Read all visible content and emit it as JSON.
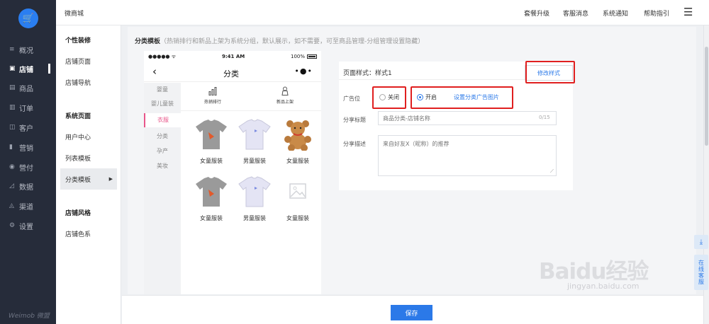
{
  "brand": "Weimob 微盟",
  "nav": [
    {
      "icon": "≡",
      "label": "概况",
      "active": false
    },
    {
      "icon": "▣",
      "label": "店铺",
      "active": true
    },
    {
      "icon": "▤",
      "label": "商品",
      "active": false
    },
    {
      "icon": "▥",
      "label": "订单",
      "active": false
    },
    {
      "icon": "◫",
      "label": "客户",
      "active": false
    },
    {
      "icon": "▮",
      "label": "营销",
      "active": false
    },
    {
      "icon": "◉",
      "label": "營付",
      "active": false
    },
    {
      "icon": "◿",
      "label": "数据",
      "active": false
    },
    {
      "icon": "◬",
      "label": "渠道",
      "active": false
    },
    {
      "icon": "⚙",
      "label": "设置",
      "active": false
    }
  ],
  "header": {
    "title": "微商城",
    "links": [
      "套餐升级",
      "客服消息",
      "系统通知",
      "帮助指引"
    ],
    "menu_icon": "☰"
  },
  "subnav": {
    "h1": "个性装修",
    "i1": "店铺页面",
    "i2": "店铺导航",
    "h2": "系统页面",
    "i3": "用户中心",
    "i4": "列表模板",
    "i5": "分类模板",
    "h3": "店铺风格",
    "i6": "店铺色系"
  },
  "section": {
    "title": "分类模板",
    "note": "（热销排行和新品上架为系统分组，默认展示，如不需要，可至商品管理-分组管理设置隐藏）"
  },
  "phone": {
    "signal": "●●●●● ᯤ",
    "time": "9:41 AM",
    "battery": "100%",
    "title": "分类",
    "back": "‹",
    "more": "•●•",
    "categories": [
      "婴童",
      "婴儿童装",
      "衣服",
      "分类",
      "孕产",
      "美妆"
    ],
    "active_category": "衣服",
    "tabs": [
      {
        "icon": "📶",
        "label": "热销排行"
      },
      {
        "icon": "♙",
        "label": "新品上架"
      }
    ],
    "products": [
      "女童服装",
      "男童服装",
      "女童服装",
      "女童服装",
      "男童服装",
      "女童服装"
    ]
  },
  "settings": {
    "page_style": "页面样式：样式1",
    "edit_style": "修改样式",
    "ad_label": "广告位",
    "ad_off": "关闭",
    "ad_on": "开启",
    "ad_link": "设置分类广告图片",
    "share_title_label": "分享标题",
    "share_title_placeholder": "商品分类-店铺名称",
    "share_title_counter": "0/15",
    "share_desc_label": "分享描述",
    "share_desc_placeholder": "来自好友X（昵称）的推荐"
  },
  "footer": {
    "save": "保存"
  },
  "side_tools": {
    "download": "⤓",
    "service": "在线客服"
  },
  "watermark": {
    "text": "Baidu经验",
    "url": "jingyan.baidu.com"
  },
  "colors": {
    "accent": "#2b79e8",
    "highlight": "#e01f1f",
    "active_category": "#e8568a"
  }
}
